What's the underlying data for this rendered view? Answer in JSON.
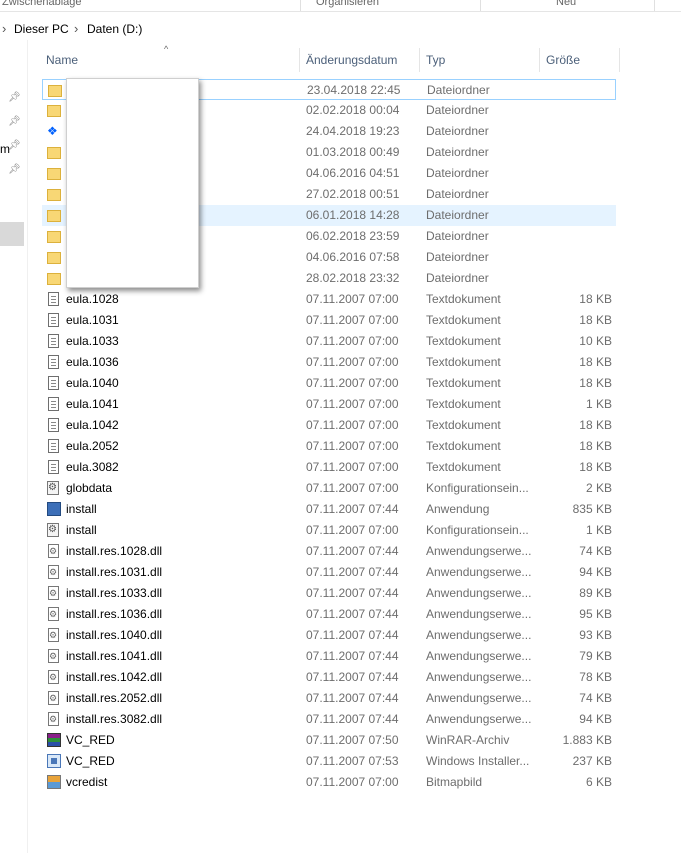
{
  "ribbon": {
    "group_clipboard": "Zwischenablage",
    "group_organize": "Organisieren",
    "group_new": "Neu"
  },
  "address": {
    "crumbs": [
      "Dieser PC",
      "Daten (D:)"
    ]
  },
  "columns": {
    "name": "Name",
    "date": "Änderungsdatum",
    "type": "Typ",
    "size": "Größe"
  },
  "nav": {
    "partial_label": "m"
  },
  "files": [
    {
      "name": "",
      "date": "23.04.2018 22:45",
      "type": "Dateiordner",
      "size": "",
      "icon": "folder-icon"
    },
    {
      "name": "",
      "date": "02.02.2018 00:04",
      "type": "Dateiordner",
      "size": "",
      "icon": "folder-icon"
    },
    {
      "name": "",
      "date": "24.04.2018 19:23",
      "type": "Dateiordner",
      "size": "",
      "icon": "dropbox-icon"
    },
    {
      "name": "",
      "date": "01.03.2018 00:49",
      "type": "Dateiordner",
      "size": "",
      "icon": "folder-icon"
    },
    {
      "name": "",
      "date": "04.06.2016 04:51",
      "type": "Dateiordner",
      "size": "",
      "icon": "folder-icon"
    },
    {
      "name": "",
      "date": "27.02.2018 00:51",
      "type": "Dateiordner",
      "size": "",
      "icon": "folder-icon"
    },
    {
      "name": "",
      "date": "06.01.2018 14:28",
      "type": "Dateiordner",
      "size": "",
      "icon": "folder-icon"
    },
    {
      "name": "",
      "date": "06.02.2018 23:59",
      "type": "Dateiordner",
      "size": "",
      "icon": "folder-icon"
    },
    {
      "name": "",
      "date": "04.06.2016 07:58",
      "type": "Dateiordner",
      "size": "",
      "icon": "folder-icon"
    },
    {
      "name": "",
      "date": "28.02.2018 23:32",
      "type": "Dateiordner",
      "size": "",
      "icon": "folder-icon"
    },
    {
      "name": "eula.1028",
      "date": "07.11.2007 07:00",
      "type": "Textdokument",
      "size": "18 KB",
      "icon": "text-file-icon"
    },
    {
      "name": "eula.1031",
      "date": "07.11.2007 07:00",
      "type": "Textdokument",
      "size": "18 KB",
      "icon": "text-file-icon"
    },
    {
      "name": "eula.1033",
      "date": "07.11.2007 07:00",
      "type": "Textdokument",
      "size": "10 KB",
      "icon": "text-file-icon"
    },
    {
      "name": "eula.1036",
      "date": "07.11.2007 07:00",
      "type": "Textdokument",
      "size": "18 KB",
      "icon": "text-file-icon"
    },
    {
      "name": "eula.1040",
      "date": "07.11.2007 07:00",
      "type": "Textdokument",
      "size": "18 KB",
      "icon": "text-file-icon"
    },
    {
      "name": "eula.1041",
      "date": "07.11.2007 07:00",
      "type": "Textdokument",
      "size": "1 KB",
      "icon": "text-file-icon"
    },
    {
      "name": "eula.1042",
      "date": "07.11.2007 07:00",
      "type": "Textdokument",
      "size": "18 KB",
      "icon": "text-file-icon"
    },
    {
      "name": "eula.2052",
      "date": "07.11.2007 07:00",
      "type": "Textdokument",
      "size": "18 KB",
      "icon": "text-file-icon"
    },
    {
      "name": "eula.3082",
      "date": "07.11.2007 07:00",
      "type": "Textdokument",
      "size": "18 KB",
      "icon": "text-file-icon"
    },
    {
      "name": "globdata",
      "date": "07.11.2007 07:00",
      "type": "Konfigurationsein...",
      "size": "2 KB",
      "icon": "config-file-icon"
    },
    {
      "name": "install",
      "date": "07.11.2007 07:44",
      "type": "Anwendung",
      "size": "835 KB",
      "icon": "application-icon"
    },
    {
      "name": "install",
      "date": "07.11.2007 07:00",
      "type": "Konfigurationsein...",
      "size": "1 KB",
      "icon": "config-file-icon"
    },
    {
      "name": "install.res.1028.dll",
      "date": "07.11.2007 07:44",
      "type": "Anwendungserwe...",
      "size": "74 KB",
      "icon": "dll-file-icon"
    },
    {
      "name": "install.res.1031.dll",
      "date": "07.11.2007 07:44",
      "type": "Anwendungserwe...",
      "size": "94 KB",
      "icon": "dll-file-icon"
    },
    {
      "name": "install.res.1033.dll",
      "date": "07.11.2007 07:44",
      "type": "Anwendungserwe...",
      "size": "89 KB",
      "icon": "dll-file-icon"
    },
    {
      "name": "install.res.1036.dll",
      "date": "07.11.2007 07:44",
      "type": "Anwendungserwe...",
      "size": "95 KB",
      "icon": "dll-file-icon"
    },
    {
      "name": "install.res.1040.dll",
      "date": "07.11.2007 07:44",
      "type": "Anwendungserwe...",
      "size": "93 KB",
      "icon": "dll-file-icon"
    },
    {
      "name": "install.res.1041.dll",
      "date": "07.11.2007 07:44",
      "type": "Anwendungserwe...",
      "size": "79 KB",
      "icon": "dll-file-icon"
    },
    {
      "name": "install.res.1042.dll",
      "date": "07.11.2007 07:44",
      "type": "Anwendungserwe...",
      "size": "78 KB",
      "icon": "dll-file-icon"
    },
    {
      "name": "install.res.2052.dll",
      "date": "07.11.2007 07:44",
      "type": "Anwendungserwe...",
      "size": "74 KB",
      "icon": "dll-file-icon"
    },
    {
      "name": "install.res.3082.dll",
      "date": "07.11.2007 07:44",
      "type": "Anwendungserwe...",
      "size": "94 KB",
      "icon": "dll-file-icon"
    },
    {
      "name": "VC_RED",
      "date": "07.11.2007 07:50",
      "type": "WinRAR-Archiv",
      "size": "1.883 KB",
      "icon": "winrar-archive-icon"
    },
    {
      "name": "VC_RED",
      "date": "07.11.2007 07:53",
      "type": "Windows Installer...",
      "size": "237 KB",
      "icon": "installer-icon"
    },
    {
      "name": "vcredist",
      "date": "07.11.2007 07:00",
      "type": "Bitmapbild",
      "size": "6 KB",
      "icon": "bitmap-icon"
    }
  ]
}
